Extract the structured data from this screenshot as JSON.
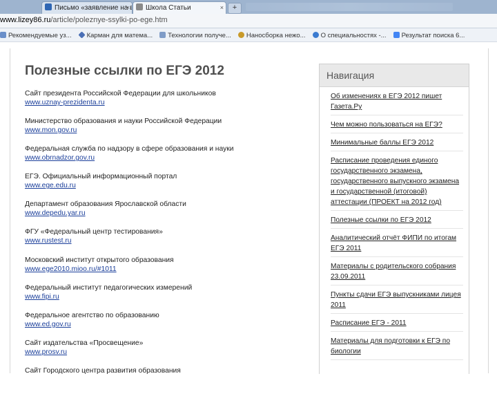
{
  "browser": {
    "tabs": [
      {
        "label": "Письмо «заявление на вып",
        "close": "×",
        "active": false
      },
      {
        "label": "Школа Статьи",
        "close": "×",
        "active": true
      }
    ],
    "new_tab": "+",
    "address": {
      "domain": "www.lizey86.ru",
      "path": "/article/poleznye-ssylki-po-ege.htm"
    },
    "bookmarks": [
      {
        "label": "Рекомендуемые уз...",
        "icon": "page-icon",
        "color": "#6a8fc9"
      },
      {
        "label": "Карман для матема...",
        "icon": "diamond-icon",
        "color": "#4a6fb5"
      },
      {
        "label": "Технологии получе...",
        "icon": "page-icon",
        "color": "#7f9cc7"
      },
      {
        "label": "Наносборка нежо...",
        "icon": "gear-icon",
        "color": "#c89a2a"
      },
      {
        "label": "О специальностях -...",
        "icon": "globe-icon",
        "color": "#3b7bd0"
      },
      {
        "label": "Результат поиска 6...",
        "icon": "google-icon",
        "color": "#4285f4"
      }
    ]
  },
  "page": {
    "title": "Полезные ссылки по ЕГЭ 2012",
    "links": [
      {
        "name": "Сайт президента Российской Федерации для школьников",
        "url": "www.uznay-prezidenta.ru"
      },
      {
        "name": "Министерство образования и науки Российской Федерации",
        "url": "www.mon.gov.ru"
      },
      {
        "name": "Федеральная служба по надзору в сфере образования и науки",
        "url": "www.obrnadzor.gov.ru"
      },
      {
        "name": "ЕГЭ. Официальный информационный портал",
        "url": "www.ege.edu.ru"
      },
      {
        "name": "Департамент образования Ярославской области",
        "url": "www.depedu.yar.ru"
      },
      {
        "name": "ФГУ «Федеральный центр тестирования»",
        "url": "www.rustest.ru"
      },
      {
        "name": "Московский институт открытого образования",
        "url": "www.ege2010.mioo.ru/#1011"
      },
      {
        "name": "Федеральный институт педагогических измерений",
        "url": "www.fipi.ru"
      },
      {
        "name": "Федеральное агентство по образованию",
        "url": "www.ed.gov.ru"
      },
      {
        "name": "Сайт издательства «Просвещение»",
        "url": "www.prosv.ru"
      },
      {
        "name": "Сайт Городского центра развития образования",
        "url": ""
      }
    ]
  },
  "navigation": {
    "header": "Навигация",
    "items": [
      "Об изменениях в ЕГЭ 2012 пишет Газета.Ру",
      "Чем можно пользоваться на ЕГЭ?",
      "Минимальные баллы ЕГЭ 2012",
      "Расписание проведения единого государственного экзамена, государственного выпускного экзамена и государственной (итоговой) аттестации (ПРОЕКТ на 2012 год)",
      "Полезные ссылки по ЕГЭ 2012",
      "Аналитический отчёт ФИПИ по итогам ЕГЭ 2011",
      "Материалы с родительского собрания 23.09.2011",
      "Пункты сдачи ЕГЭ выпускниками лицея 2011",
      "Расписание ЕГЭ - 2011",
      "Материалы для подготовки к ЕГЭ по биологии"
    ]
  }
}
